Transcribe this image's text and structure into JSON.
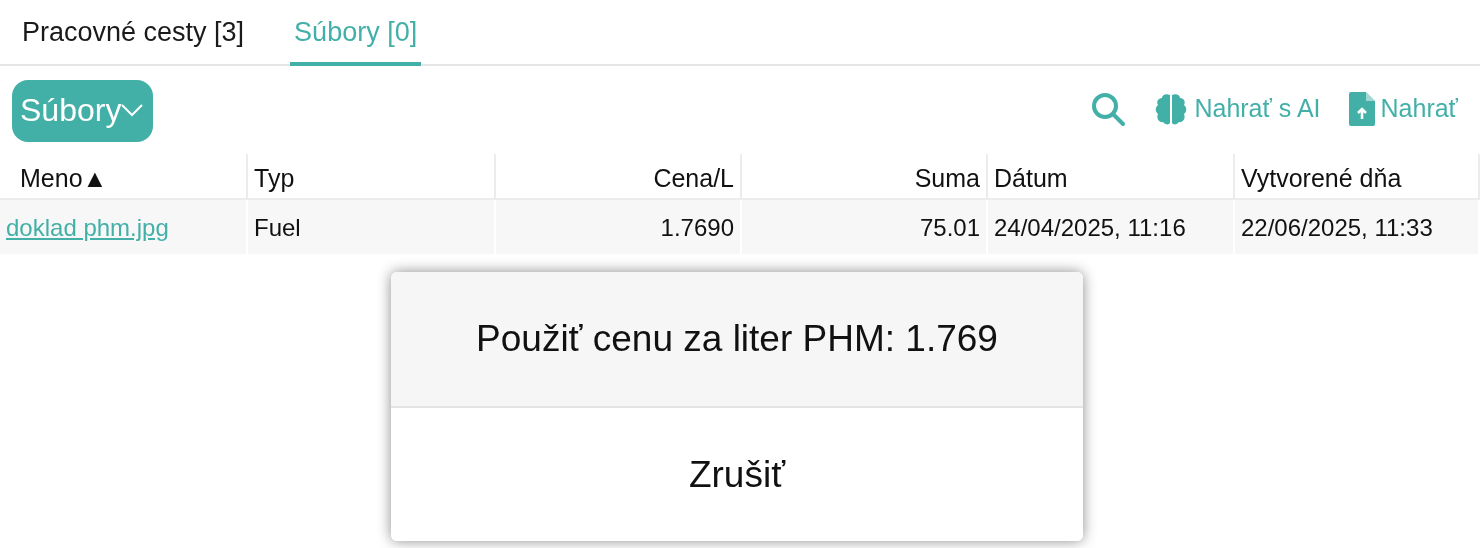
{
  "tabs": [
    {
      "label": "Pracovné cesty [3]",
      "selected": false
    },
    {
      "label": "Súbory [0]",
      "selected": true
    }
  ],
  "menu_button": {
    "label": "Súbory"
  },
  "toolbar": [
    {
      "kind": "search"
    },
    {
      "kind": "ai_upload",
      "label": "Nahrať s AI"
    },
    {
      "kind": "upload",
      "label": "Nahrať"
    }
  ],
  "table": {
    "columns": [
      {
        "label": "Meno",
        "sort_mark": "▲"
      },
      {
        "label": "Typ"
      },
      {
        "label": "Cena/L"
      },
      {
        "label": "Suma"
      },
      {
        "label": "Dátum"
      },
      {
        "label": "Vytvorené dňa"
      }
    ],
    "rows": [
      {
        "cells": [
          "doklad phm.jpg",
          "Fuel",
          "1.7690",
          "75.01",
          "24/04/2025, 11:16",
          "22/06/2025, 11:33"
        ]
      }
    ]
  },
  "popup": {
    "options": [
      {
        "label": "Použiť cenu za liter PHM: 1.769"
      },
      {
        "label": "Zrušiť"
      }
    ]
  }
}
